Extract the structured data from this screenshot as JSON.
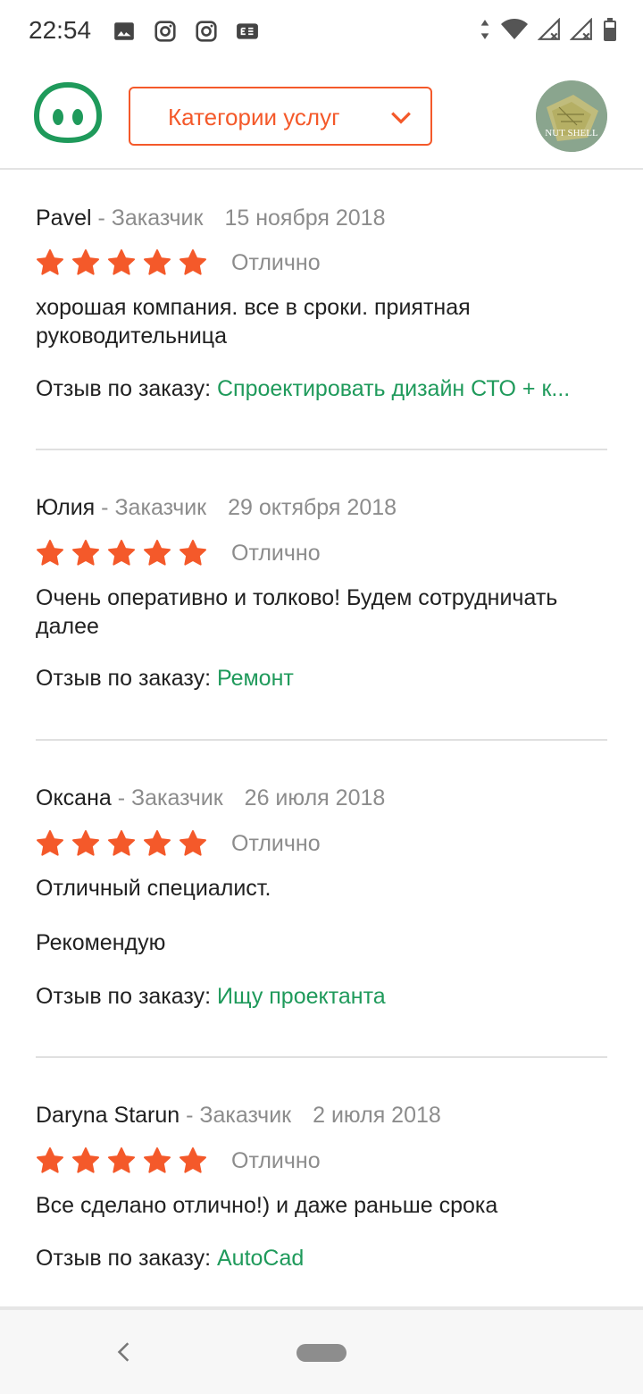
{
  "status_bar": {
    "time": "22:54",
    "left_icons": [
      "image-icon",
      "instagram-icon",
      "instagram-icon",
      "translate-icon"
    ],
    "right_icons": [
      "data-arrows-icon",
      "wifi-icon",
      "signal-icon",
      "signal-icon",
      "battery-icon"
    ],
    "network_badge": "4"
  },
  "header": {
    "logo_icon": "app-logo-icon",
    "category_select": {
      "label": "Категории услуг",
      "icon": "chevron-down-icon"
    },
    "avatar_text": "NUT SHELL"
  },
  "colors": {
    "accent": "#f4592a",
    "link": "#1f9a5b",
    "muted": "#8c8c8c",
    "logo_green": "#1f9a5b"
  },
  "reviews": [
    {
      "author": "Pavel",
      "role": " - Заказчик",
      "date": "15 ноября 2018",
      "rating_text": "Отлично",
      "stars": 5,
      "text": "хорошая компания. все в сроки. приятная руководительница",
      "order_label": "Отзыв по заказу: ",
      "order_link": "Спроектировать дизайн СТО + к..."
    },
    {
      "author": "Юлия",
      "role": " - Заказчик",
      "date": "29 октября 2018",
      "rating_text": "Отлично",
      "stars": 5,
      "text": "Очень оперативно и толково! Будем сотрудничать далее",
      "order_label": "Отзыв по заказу: ",
      "order_link": "Ремонт"
    },
    {
      "author": "Оксана",
      "role": " - Заказчик",
      "date": "26 июля 2018",
      "rating_text": "Отлично",
      "stars": 5,
      "text": "Отличный специалист.",
      "text2": "Рекомендую",
      "order_label": "Отзыв по заказу: ",
      "order_link": "Ищу проектанта"
    },
    {
      "author": "Daryna Starun",
      "role": " - Заказчик",
      "date": "2 июля 2018",
      "rating_text": "Отлично",
      "stars": 5,
      "text": "Все сделано отлично!) и даже раньше срока",
      "order_label": "Отзыв по заказу: ",
      "order_link": "AutoCad"
    }
  ],
  "nav": {
    "back_icon": "back-icon",
    "home_icon": "home-pill-icon"
  }
}
